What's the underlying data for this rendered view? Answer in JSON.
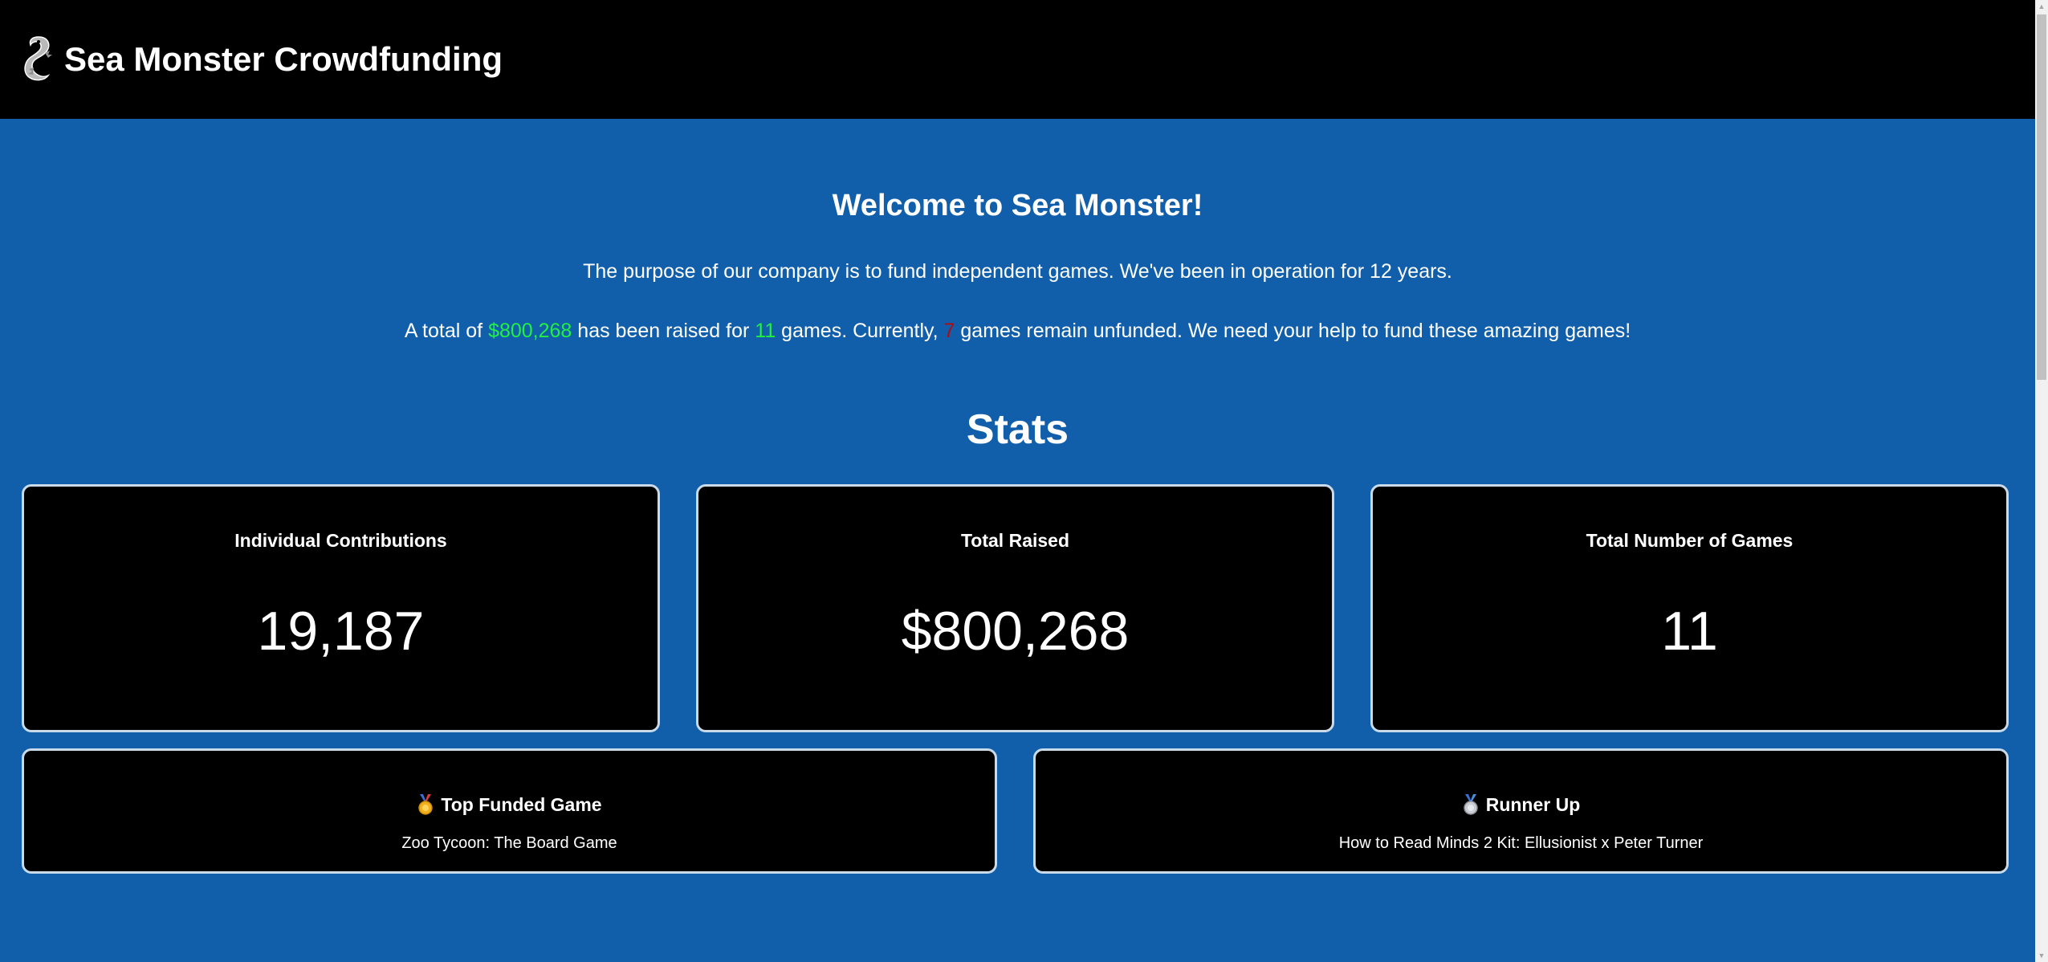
{
  "header": {
    "title": "Sea Monster Crowdfunding",
    "logo_icon": "sea-serpent-logo-icon"
  },
  "welcome": {
    "title": "Welcome to Sea Monster!",
    "purpose": "The purpose of our company is to fund independent games. We've been in operation for 12 years.",
    "summary_prefix": "A total of ",
    "raised": "$800,268",
    "summary_mid1": " has been raised for ",
    "funded_count": "11",
    "summary_mid2": " games. Currently, ",
    "unfunded_count": "7",
    "summary_suffix": " games remain unfunded. We need your help to fund these amazing games!"
  },
  "stats": {
    "title": "Stats",
    "cards": [
      {
        "label": "Individual Contributions",
        "value": "19,187"
      },
      {
        "label": "Total Raised",
        "value": "$800,268"
      },
      {
        "label": "Total Number of Games",
        "value": "11"
      }
    ],
    "top_funded": {
      "label": "Top Funded Game",
      "icon": "gold-medal-icon",
      "game": "Zoo Tycoon: The Board Game"
    },
    "runner_up": {
      "label": "Runner Up",
      "icon": "silver-medal-icon",
      "game": "How to Read Minds 2 Kit: Ellusionist x Peter Turner"
    }
  },
  "colors": {
    "background": "#115fab",
    "header": "#000000",
    "card": "#000000",
    "card_border": "#c9daeb",
    "funded_highlight": "#22ee44",
    "unfunded_highlight": "#b40a0a"
  }
}
